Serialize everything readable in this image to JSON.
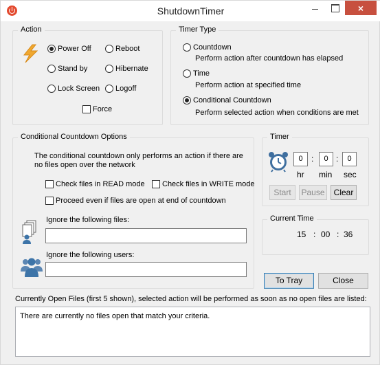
{
  "window": {
    "title": "ShutdownTimer",
    "close_glyph": "×"
  },
  "action": {
    "group_label": "Action",
    "power_off": "Power Off",
    "reboot": "Reboot",
    "stand_by": "Stand by",
    "hibernate": "Hibernate",
    "lock_screen": "Lock Screen",
    "logoff": "Logoff",
    "force": "Force",
    "selected": "power_off",
    "force_checked": false
  },
  "timer_type": {
    "group_label": "Timer Type",
    "countdown": "Countdown",
    "countdown_desc": "Perform action after countdown has elapsed",
    "time": "Time",
    "time_desc": "Perform action at specified time",
    "conditional": "Conditional Countdown",
    "conditional_desc": "Perform selected action when conditions are met",
    "selected": "conditional"
  },
  "conditional_options": {
    "group_label": "Conditional Countdown Options",
    "description_line1": "The conditional countdown only performs an action if there are",
    "description_line2": "no files open over the network",
    "check_read": "Check files in READ mode",
    "check_write": "Check files in WRITE mode",
    "proceed": "Proceed even if files are open at end of countdown",
    "ignore_files_label": "Ignore the following files:",
    "ignore_files_value": "",
    "ignore_users_label": "Ignore the following users:",
    "ignore_users_value": ""
  },
  "timer": {
    "group_label": "Timer",
    "hr": "0",
    "min": "0",
    "sec": "0",
    "hr_label": "hr",
    "min_label": "min",
    "sec_label": "sec",
    "colon": ":",
    "start": "Start",
    "pause": "Pause",
    "clear": "Clear"
  },
  "current_time": {
    "group_label": "Current Time",
    "hours": "15",
    "minutes": "00",
    "seconds": "36",
    "colon": ":"
  },
  "buttons": {
    "to_tray": "To Tray",
    "close": "Close"
  },
  "open_files": {
    "label": "Currently Open Files (first 5 shown), selected action will be performed as soon as no open files are listed:",
    "status": "There are currently no files open that match your criteria."
  },
  "colors": {
    "close_button": "#c7503f",
    "lightning": "#f0a830",
    "clock": "#3f6f9f",
    "users": "#3d74a8"
  }
}
